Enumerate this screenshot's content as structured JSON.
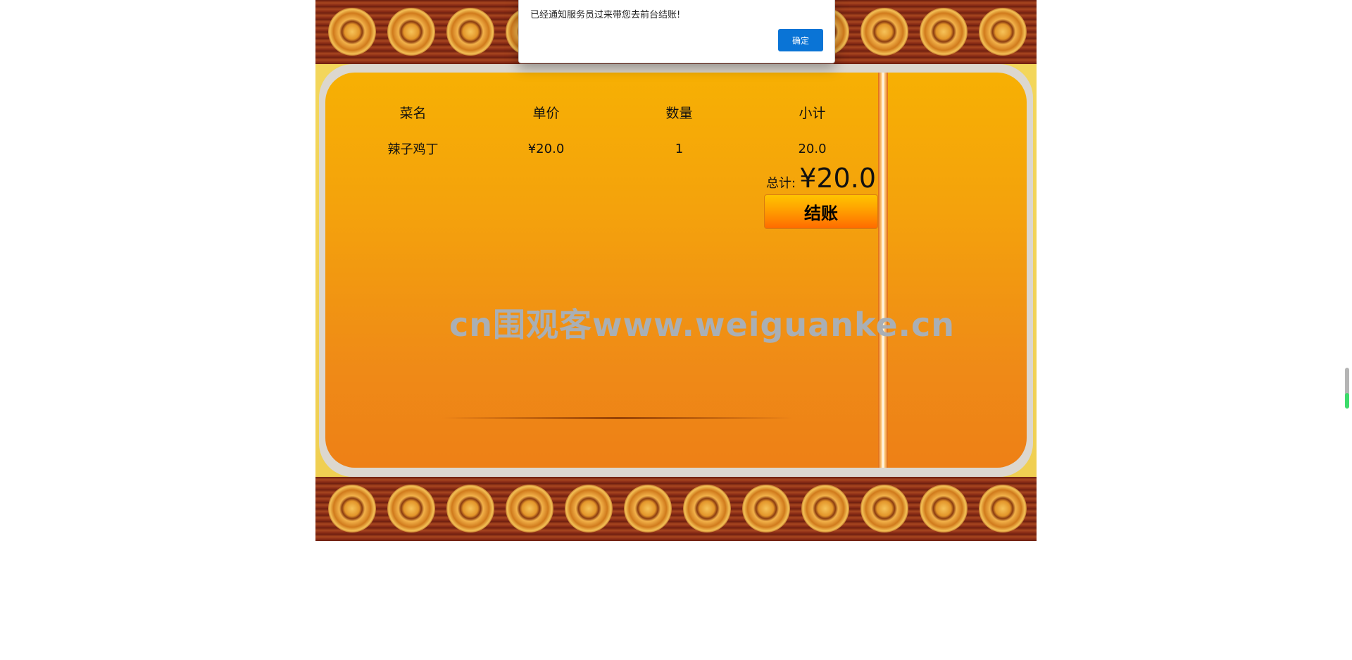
{
  "dialog": {
    "message": "已经通知服务员过来带您去前台结账!",
    "ok_label": "确定"
  },
  "order": {
    "headers": [
      "菜名",
      "单价",
      "数量",
      "小计"
    ],
    "rows": [
      {
        "name": "辣子鸡丁",
        "price": "¥20.0",
        "qty": "1",
        "subtotal": "20.0"
      }
    ],
    "total_label": "总计:",
    "total_value": "¥20.0",
    "checkout_label": "结账"
  },
  "watermark": "cn围观客www.weiguanke.cn",
  "scroll_indicator": {
    "level_fraction": 0.38
  },
  "colors": {
    "accent": "#0a74d6",
    "panel": "#f4a20c",
    "button": "#ff9a00"
  }
}
